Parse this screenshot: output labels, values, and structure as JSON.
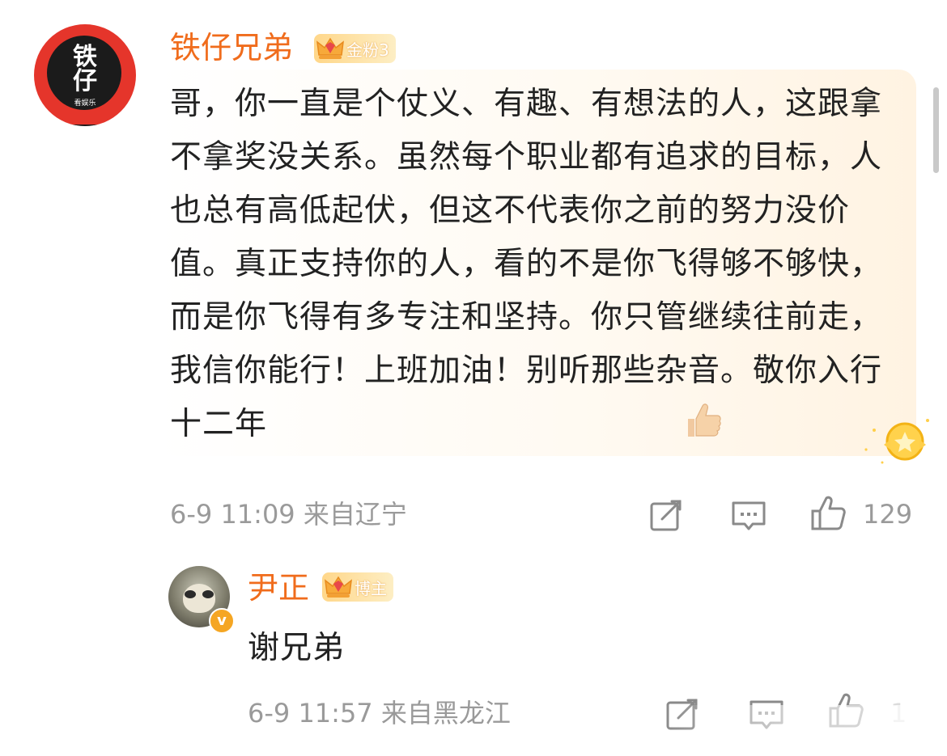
{
  "main_comment": {
    "username": "铁仔兄弟",
    "badge_label": "金粉3",
    "avatar": {
      "line1": "铁",
      "line2": "仔",
      "sub": "看娱乐"
    },
    "text": "哥，你一直是个仗义、有趣、有想法的人，这跟拿不拿奖没关系。虽然每个职业都有追求的目标，人也总有高低起伏，但这不代表你之前的努力没价值。真正支持你的人，看的不是你飞得够不够快，而是你飞得有多专注和坚持。你只管继续往前走，我信你能行！上班加油！别听那些杂音。敬你入行十二年",
    "meta": "6-9 11:09  来自辽宁",
    "like_count": "129"
  },
  "reply": {
    "username": "尹正",
    "badge_label": "博主",
    "verify_mark": "v",
    "text": "谢兄弟",
    "meta": "6-9 11:57  来自黑龙江",
    "like_count": "1"
  },
  "icons": {
    "share": "share-icon",
    "comment": "comment-icon",
    "like": "thumbs-up-icon",
    "emoji": "thumbs-up-emoji",
    "crown": "crown-icon",
    "medal": "medal-icon"
  },
  "colors": {
    "username": "#f06c1c",
    "meta": "#9a9a9a",
    "text": "#222222",
    "badge_gold": "#ffd78a",
    "avatar_red": "#e5352b"
  }
}
